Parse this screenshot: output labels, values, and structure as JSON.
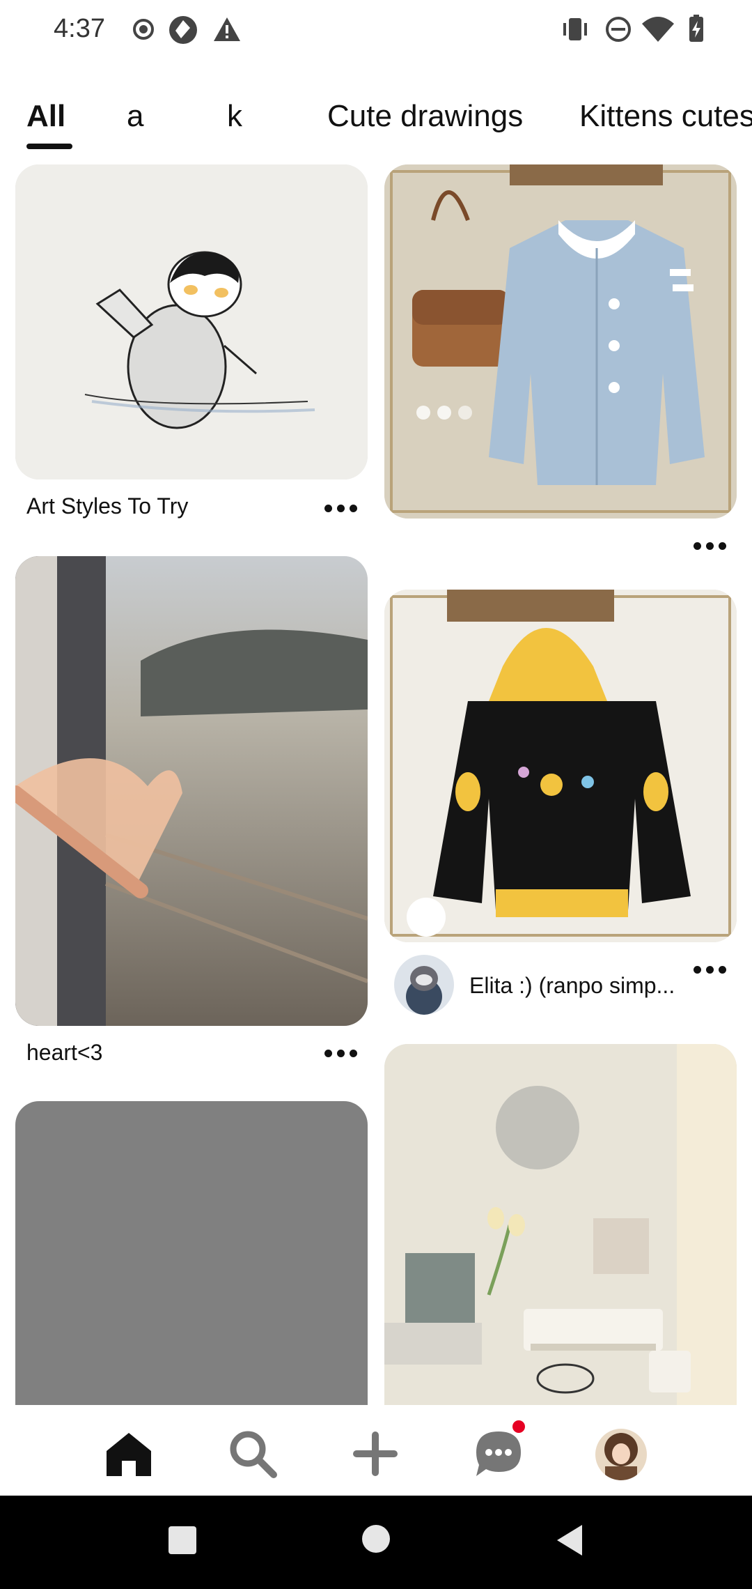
{
  "status_bar": {
    "time": "4:37",
    "left_icons": [
      "record-icon",
      "camera-shutter-icon",
      "warning-icon"
    ],
    "right_icons": [
      "vibrate-icon",
      "do-not-disturb-icon",
      "wifi-icon",
      "battery-charging-icon"
    ]
  },
  "tabs": [
    {
      "label": "All",
      "active": true
    },
    {
      "label": "a",
      "active": false
    },
    {
      "label": "k",
      "active": false
    },
    {
      "label": "Cute drawings",
      "active": false
    },
    {
      "label": "Kittens cutes",
      "active": false
    }
  ],
  "feed": {
    "pins": [
      {
        "id": "penguin",
        "caption": "Art Styles To Try",
        "image": "penguin-drawing"
      },
      {
        "id": "coat",
        "caption": "",
        "image": "light-blue-coat-photo"
      },
      {
        "id": "window",
        "caption": "heart<3",
        "image": "train-window-heart-hands"
      },
      {
        "id": "hoodie",
        "caption": "Elita :) (ranpo simp...",
        "image": "black-yellow-hoodie"
      },
      {
        "id": "gray",
        "caption": "",
        "image": "loading-placeholder"
      },
      {
        "id": "desk",
        "caption": "",
        "image": "desk-setup-photo"
      }
    ]
  },
  "bottom_nav": {
    "items": [
      "home-icon",
      "search-icon",
      "create-icon",
      "messages-icon",
      "profile-avatar"
    ],
    "messages_has_notification": true
  },
  "system_nav": [
    "recents-icon",
    "home-circle-icon",
    "back-icon"
  ],
  "colors": {
    "notification_dot": "#e60023",
    "placeholder_gray": "#808080"
  }
}
